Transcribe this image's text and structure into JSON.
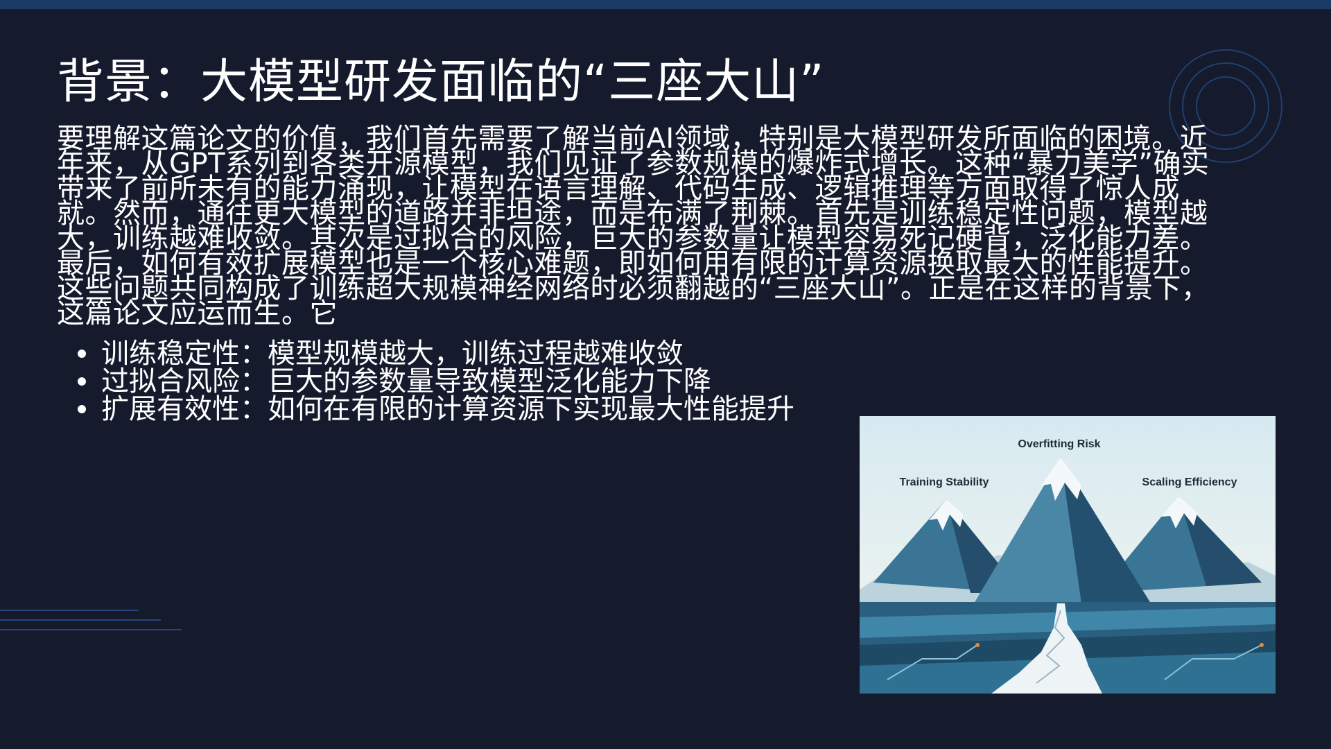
{
  "slide": {
    "title": "背景：大模型研发面临的“三座大山”",
    "paragraph": "要理解这篇论文的价值，我们首先需要了解当前AI领域，特别是大模型研发所面临的困境。近年来，从GPT系列到各类开源模型，我们见证了参数规模的爆炸式增长。这种“暴力美学”确实带来了前所未有的能力涌现，让模型在语言理解、代码生成、逻辑推理等方面取得了惊人成就。然而，通往更大模型的道路并非坦途，而是布满了荆棘。首先是训练稳定性问题，模型越大，训练越难收敛。其次是过拟合的风险，巨大的参数量让模型容易死记硬背，泛化能力差。最后，如何有效扩展模型也是一个核心难题，即如何用有限的计算资源换取最大的性能提升。这些问题共同构成了训练超大规模神经网络时必须翻越的“三座大山”。正是在这样的背景下，这篇论文应运而生。它",
    "bullets": [
      "训练稳定性：模型规模越大，训练过程越难收敛",
      "过拟合风险：巨大的参数量导致模型泛化能力下降",
      "扩展有效性：如何在有限的计算资源下实现最大性能提升"
    ]
  },
  "figure": {
    "labels": {
      "left": "Training Stability",
      "center": "Overfitting Risk",
      "right": "Scaling Efficiency"
    }
  },
  "colors": {
    "background": "#151a2d",
    "top_bar": "#1d3a66",
    "accent": "#2b5a9a",
    "text": "#ffffff"
  }
}
